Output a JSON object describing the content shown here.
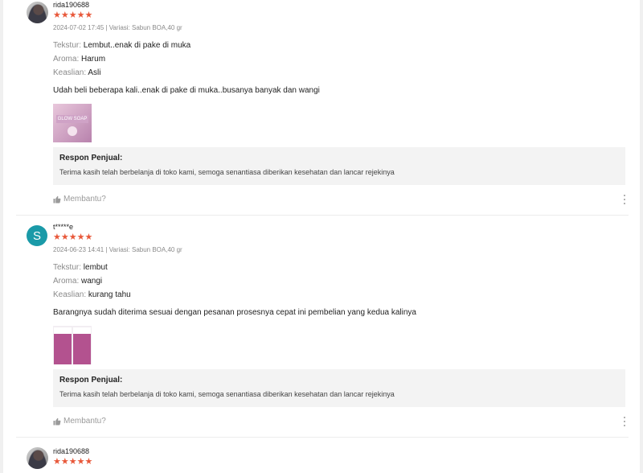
{
  "reviews": [
    {
      "username": "rida190688",
      "stars": "★★★★★",
      "meta": "2024-07-02 17:45 | Variasi: Sabun BOA,40 gr",
      "attrs": [
        {
          "key": "Tekstur:",
          "value": "Lembut..enak di pake di muka"
        },
        {
          "key": "Aroma:",
          "value": "Harum"
        },
        {
          "key": "Keaslian:",
          "value": "Asli"
        }
      ],
      "text": "Udah beli beberapa kali..enak di pake di muka..busanya banyak dan wangi",
      "thumb_label": "GLOW SOAP",
      "reply_title": "Respon Penjual:",
      "reply_text": "Terima kasih telah berbelanja di toko kami, semoga senantiasa diberikan kesehatan dan lancar rejekinya",
      "helpful": "Membantu?"
    },
    {
      "username": "t*****e",
      "avatar_letter": "S",
      "stars": "★★★★★",
      "meta": "2024-06-23 14:41 | Variasi: Sabun BOA,40 gr",
      "attrs": [
        {
          "key": "Tekstur:",
          "value": "lembut"
        },
        {
          "key": "Aroma:",
          "value": "wangi"
        },
        {
          "key": "Keaslian:",
          "value": "kurang tahu"
        }
      ],
      "text": "Barangnya sudah diterima sesuai dengan pesanan prosesnya cepat ini pembelian yang kedua kalinya",
      "reply_title": "Respon Penjual:",
      "reply_text": "Terima kasih telah berbelanja di toko kami, semoga senantiasa diberikan kesehatan dan lancar rejekinya",
      "helpful": "Membantu?"
    },
    {
      "username": "rida190688",
      "stars": "★★★★★"
    }
  ],
  "colors": {
    "star": "#e8583a",
    "avatar_s": "#1a9aa8",
    "reply_bg": "#f3f3f3"
  }
}
